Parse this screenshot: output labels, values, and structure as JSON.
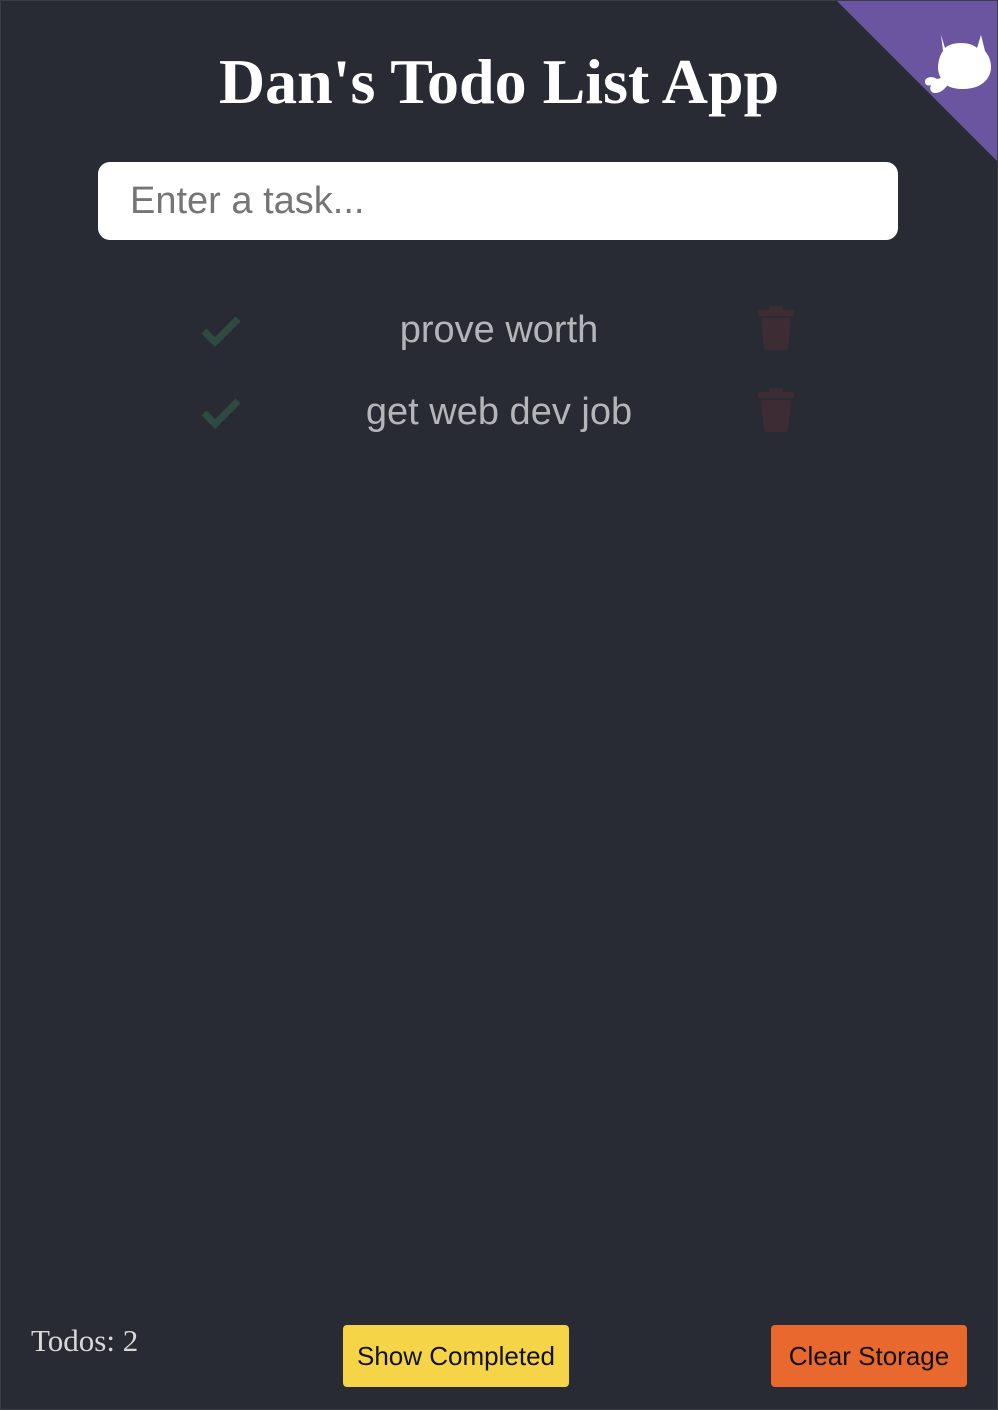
{
  "header": {
    "title": "Dan's Todo List App",
    "corner_icon": "github-octocat-icon",
    "corner_color": "#6b55a0"
  },
  "task_input": {
    "placeholder": "Enter a task...",
    "value": ""
  },
  "todos": [
    {
      "text": "prove worth",
      "check_icon": "checkmark-icon",
      "delete_icon": "trash-icon"
    },
    {
      "text": "get web dev job",
      "check_icon": "checkmark-icon",
      "delete_icon": "trash-icon"
    }
  ],
  "footer": {
    "todo_count": "Todos: 2",
    "show_completed_label": "Show Completed",
    "clear_storage_label": "Clear Storage"
  },
  "colors": {
    "background": "#282b33",
    "show_completed": "#f5d547",
    "clear_storage": "#e8682d",
    "check": "#2f4a40",
    "trash": "#3d2c33"
  }
}
